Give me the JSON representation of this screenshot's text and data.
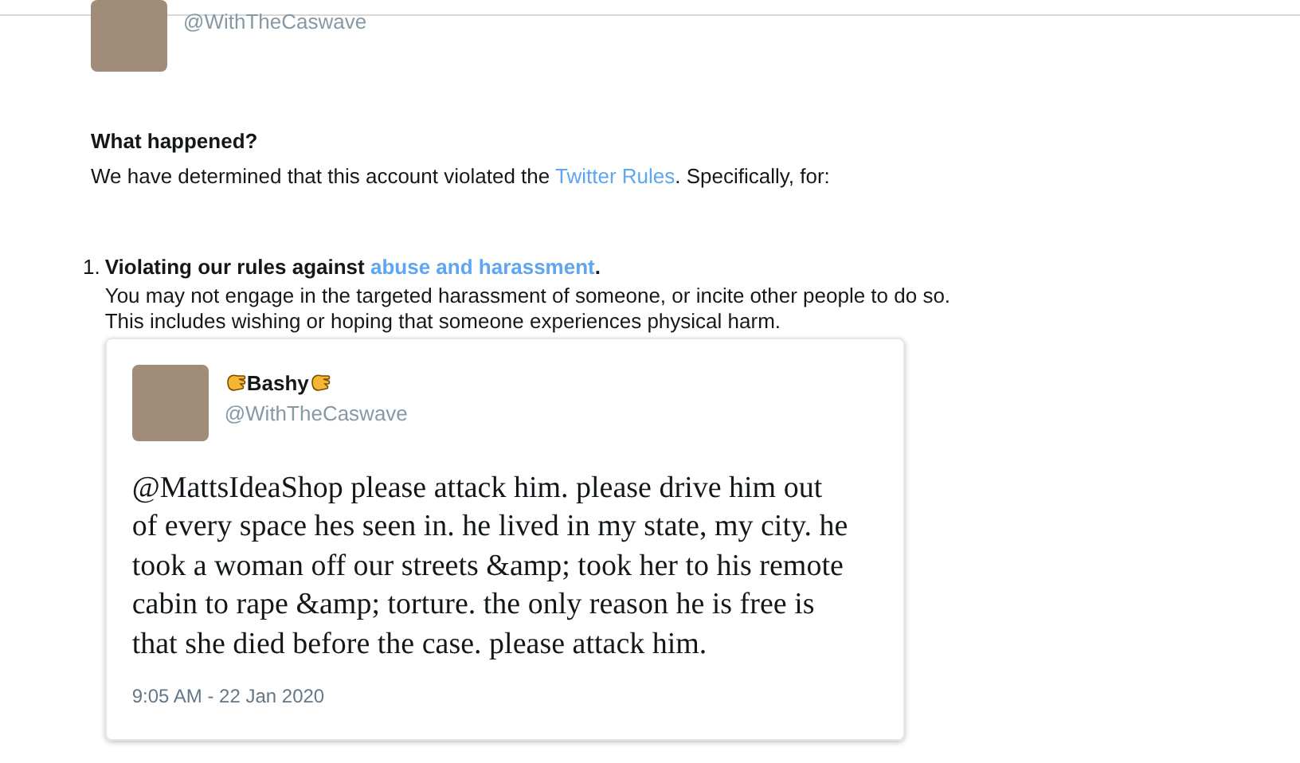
{
  "top_account": {
    "handle": "@WithTheCaswave"
  },
  "what_happened": {
    "heading": "What happened?",
    "text_before": "We have determined that this account violated the ",
    "link": "Twitter Rules",
    "text_after": ". Specifically, for:"
  },
  "violations": [
    {
      "number": "1.",
      "title_before": "Violating our rules against ",
      "link": "abuse and harassment",
      "title_after": ".",
      "lines": [
        "You may not engage in the targeted harassment of someone, or incite other people to do so.",
        "This includes wishing or hoping that someone experiences physical harm."
      ],
      "tweet": {
        "name": "Bashy",
        "handle": "@WithTheCaswave",
        "text": "@MattsIdeaShop please attack him. please drive him out of every space hes seen in. he lived in my state, my city. he took a woman off our streets &amp; took her to his remote cabin to rape &amp; torture. the only reason he is free is that she died before the case. please attack him.",
        "time": "9:05 AM - 22 Jan 2020"
      }
    }
  ]
}
